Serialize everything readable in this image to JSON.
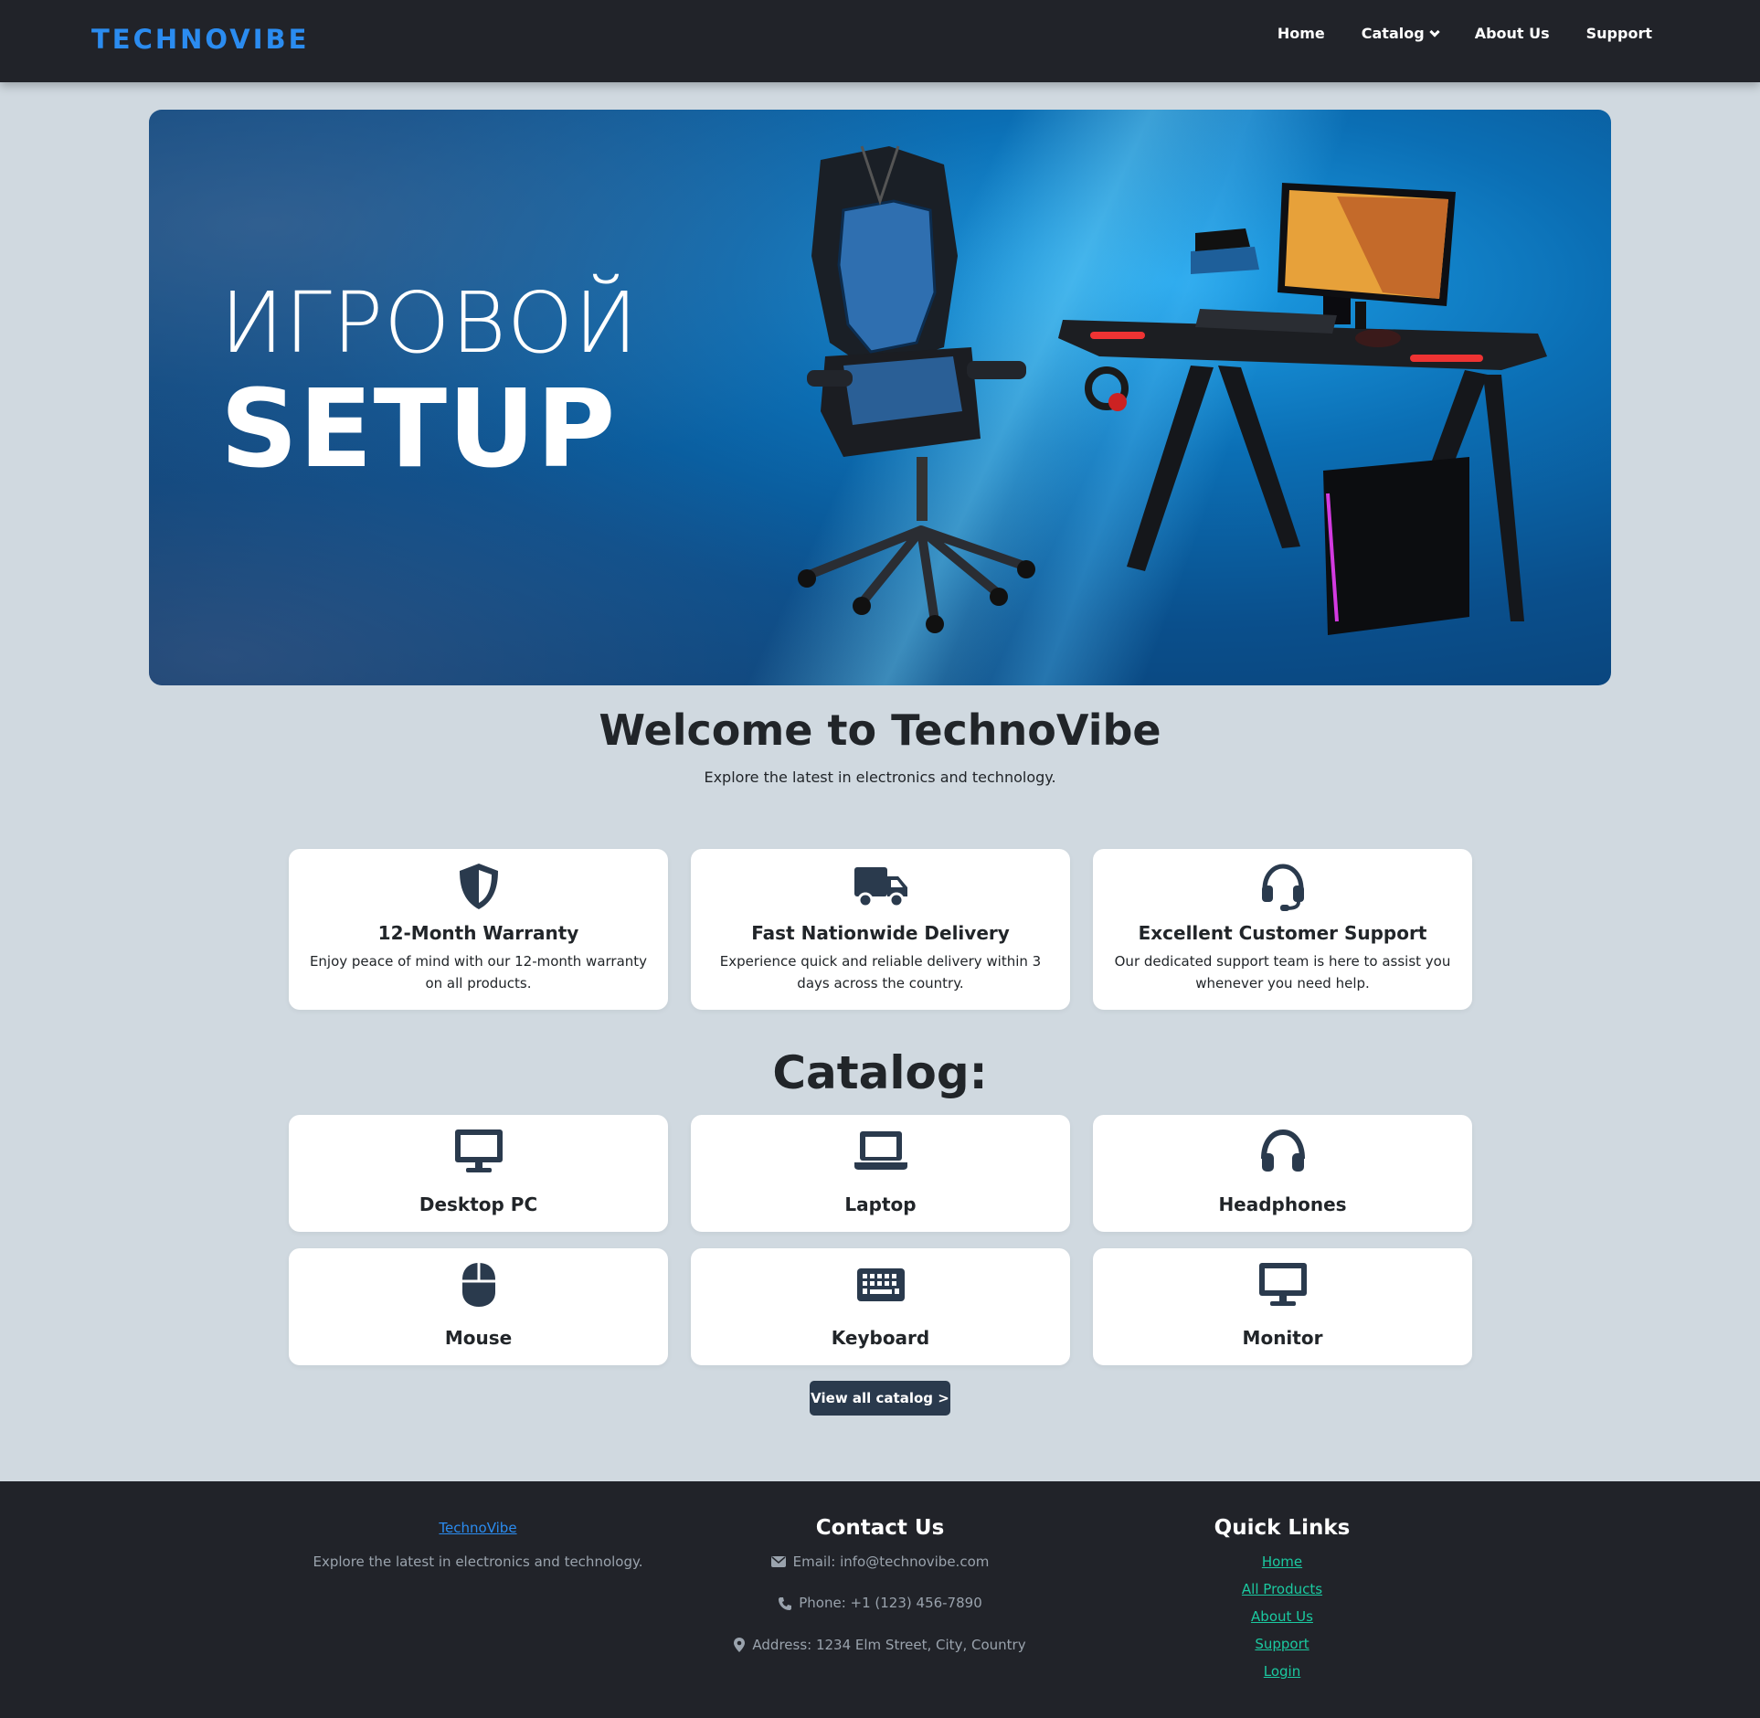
{
  "nav": {
    "brand": "TECHNOVIBE",
    "links": [
      {
        "label": "Home"
      },
      {
        "label": "Catalog"
      },
      {
        "label": "About Us"
      },
      {
        "label": "Support"
      }
    ]
  },
  "hero": {
    "line1": "ИГРОВОЙ",
    "line2": "SETUP"
  },
  "welcome": {
    "title": "Welcome to TechnoVibe",
    "subtitle": "Explore the latest in electronics and technology."
  },
  "features": [
    {
      "icon": "shield-icon",
      "title": "12-Month Warranty",
      "text": "Enjoy peace of mind with our 12-month warranty on all products."
    },
    {
      "icon": "truck-icon",
      "title": "Fast Nationwide Delivery",
      "text": "Experience quick and reliable delivery within 3 days across the country."
    },
    {
      "icon": "headset-icon",
      "title": "Excellent Customer Support",
      "text": "Our dedicated support team is here to assist you whenever you need help."
    }
  ],
  "catalog": {
    "title": "Catalog:",
    "items": [
      {
        "icon": "desktop-icon",
        "label": "Desktop PC"
      },
      {
        "icon": "laptop-icon",
        "label": "Laptop"
      },
      {
        "icon": "headphones-icon",
        "label": "Headphones"
      },
      {
        "icon": "mouse-icon",
        "label": "Mouse"
      },
      {
        "icon": "keyboard-icon",
        "label": "Keyboard"
      },
      {
        "icon": "monitor-icon",
        "label": "Monitor"
      }
    ],
    "view_all": "View all catalog >"
  },
  "footer": {
    "brand_link": "TechnoVibe",
    "tagline": "Explore the latest in electronics and technology.",
    "contact_heading": "Contact Us",
    "email": "Email: info@technovibe.com",
    "phone": "Phone: +1 (123) 456-7890",
    "address": "Address: 1234 Elm Street, City, Country",
    "quick_heading": "Quick Links",
    "quick_links": [
      "Home",
      "All Products",
      "About Us",
      "Support",
      "Login"
    ]
  },
  "colors": {
    "brand": "#2b8cf0",
    "navbar_bg": "#212329",
    "page_bg": "#d0d9e0",
    "icon": "#2a3a4d",
    "footer_link": "#1bc9a0",
    "button_bg": "#2a3a4d"
  }
}
